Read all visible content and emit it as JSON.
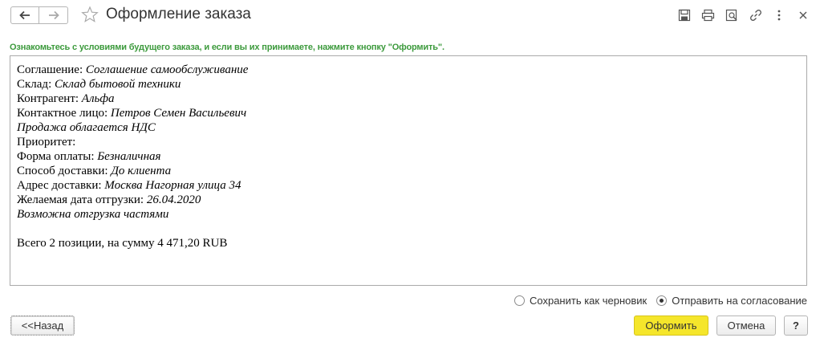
{
  "window": {
    "title": "Оформление заказа"
  },
  "hint": "Ознакомьтесь с условиями будущего заказа, и если вы их принимаете, нажмите кнопку \"Оформить\".",
  "summary": {
    "agreement_label": "Соглашение: ",
    "agreement_value": "Соглашение самообслуживание",
    "warehouse_label": "Склад: ",
    "warehouse_value": "Склад бытовой техники",
    "counterparty_label": "Контрагент: ",
    "counterparty_value": "Альфа",
    "contact_label": "Контактное лицо: ",
    "contact_value": "Петров Семен Васильевич",
    "vat_note": "Продажа облагается НДС",
    "priority_label": "Приоритет:",
    "payment_label": "Форма оплаты: ",
    "payment_value": "Безналичная",
    "delivery_label": "Способ доставки: ",
    "delivery_value": "До клиента",
    "address_label": "Адрес доставки: ",
    "address_value": "Москва Нагорная улица 34",
    "ship_date_label": "Желаемая дата отгрузки: ",
    "ship_date_value": "26.04.2020",
    "partial_note": "Возможна отгрузка частями",
    "total": "Всего 2 позиции, на сумму 4 471,20  RUB"
  },
  "options": {
    "draft_label": "Сохранить как черновик",
    "draft_selected": false,
    "approval_label": "Отправить на согласование",
    "approval_selected": true
  },
  "buttons": {
    "back_label": "<<Назад",
    "submit_label": "Оформить",
    "cancel_label": "Отмена",
    "help_label": "?"
  },
  "icons": {
    "toolbar": [
      "save-icon",
      "print-icon",
      "preview-icon",
      "link-icon",
      "more-icon",
      "close-icon"
    ]
  },
  "colors": {
    "hint_text": "#3c9a3c",
    "submit_button": "#f5e62b"
  }
}
